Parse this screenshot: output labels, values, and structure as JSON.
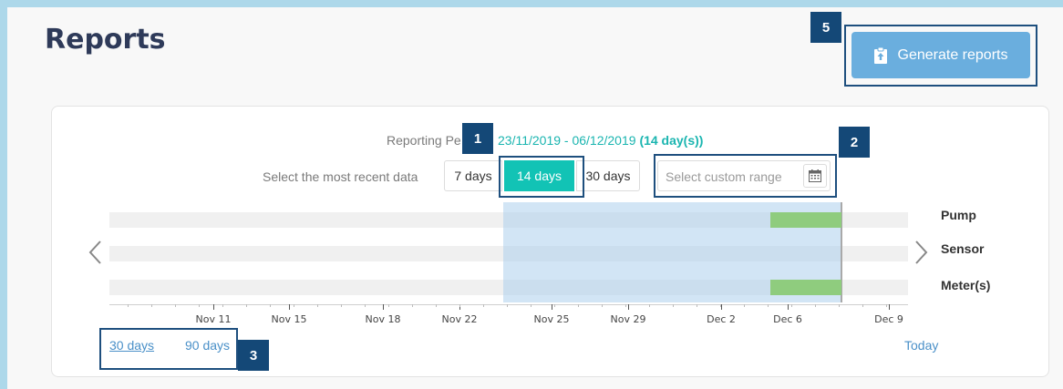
{
  "header": {
    "title": "Reports",
    "generate_label": "Generate reports"
  },
  "period": {
    "label": "Reporting Pe",
    "dates": "23/11/2019 - 06/12/2019",
    "duration": "(14 day(s))"
  },
  "range_selector": {
    "label": "Select the most recent data",
    "options": [
      {
        "label": "7 days",
        "active": false
      },
      {
        "label": "14 days",
        "active": true
      },
      {
        "label": "30 days",
        "active": false
      }
    ],
    "custom_placeholder": "Select custom range"
  },
  "timeline": {
    "lanes": [
      "Pump",
      "Sensor",
      "Meter(s)"
    ],
    "ticks": [
      "Nov 11",
      "Nov 15",
      "Nov 18",
      "Nov 22",
      "Nov 25",
      "Nov 29",
      "Dec 2",
      "Dec 6",
      "Dec 9"
    ],
    "zoom_links": [
      "30 days",
      "90 days"
    ],
    "today_label": "Today"
  },
  "callouts": [
    "1",
    "2",
    "3",
    "5"
  ],
  "colors": {
    "accent": "#12c3b5",
    "button": "#6aaede",
    "callout": "#144877",
    "data_bar": "#8fcc7e"
  }
}
